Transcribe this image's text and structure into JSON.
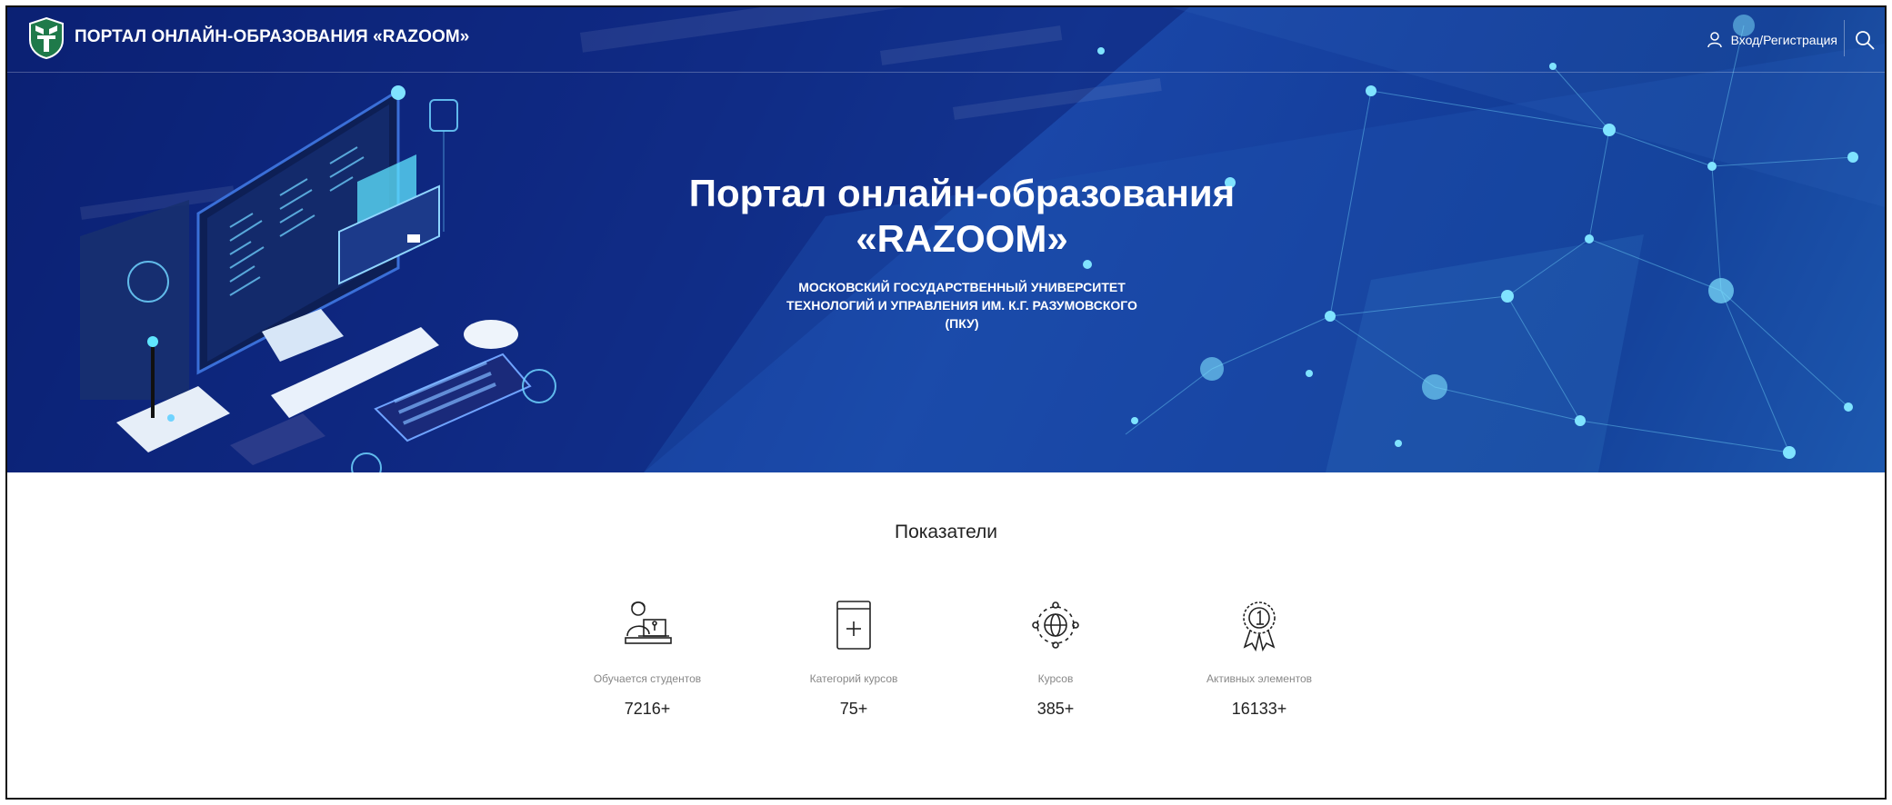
{
  "header": {
    "brand": "ПОРТАЛ ОНЛАЙН-ОБРАЗОВАНИЯ «RAZOOM»",
    "login_label": "Вход/Регистрация"
  },
  "hero": {
    "title_line1": "Портал онлайн-образования",
    "title_line2": "«RAZOOM»",
    "subtitle_line1": "МОСКОВСКИЙ ГОСУДАРСТВЕННЫЙ УНИВЕРСИТЕТ",
    "subtitle_line2": "ТЕХНОЛОГИЙ И УПРАВЛЕНИЯ ИМ. К.Г. РАЗУМОВСКОГО",
    "subtitle_line3": "(ПКУ)"
  },
  "stats": {
    "title": "Показатели",
    "items": [
      {
        "label": "Обучается студентов",
        "value": "7216+",
        "icon": "student-computer-icon"
      },
      {
        "label": "Категорий курсов",
        "value": "75+",
        "icon": "book-plus-icon"
      },
      {
        "label": "Курсов",
        "value": "385+",
        "icon": "globe-network-icon"
      },
      {
        "label": "Активных элементов",
        "value": "16133+",
        "icon": "medal-award-icon"
      }
    ]
  },
  "colors": {
    "hero_dark": "#0a1f6e",
    "hero_mid": "#1a47a8",
    "accent_cyan": "#5fe6ff",
    "logo_green": "#1f7a4a"
  }
}
